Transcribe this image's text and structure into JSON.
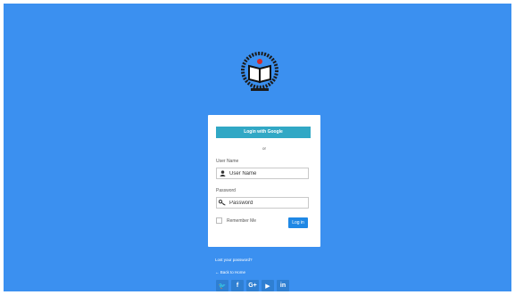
{
  "login": {
    "google_label": "Login with Google",
    "or_text": "or",
    "username_label": "User Name",
    "username_placeholder": "User Name",
    "password_label": "Password",
    "password_placeholder": "Password",
    "remember_label": "Remember Me",
    "login_label": "Log in"
  },
  "links": {
    "lost_password": "Lost your password?",
    "back_to_home": "← Back to Home"
  },
  "social": [
    {
      "icon": "twitter-icon",
      "glyph": "🐦"
    },
    {
      "icon": "facebook-icon",
      "glyph": "f"
    },
    {
      "icon": "google-plus-icon",
      "glyph": "G+"
    },
    {
      "icon": "youtube-icon",
      "glyph": "▶"
    },
    {
      "icon": "linkedin-icon",
      "glyph": "in"
    }
  ],
  "colors": {
    "background": "#3b90f0",
    "google_button": "#31a8c5",
    "login_button": "#1f88e5"
  }
}
